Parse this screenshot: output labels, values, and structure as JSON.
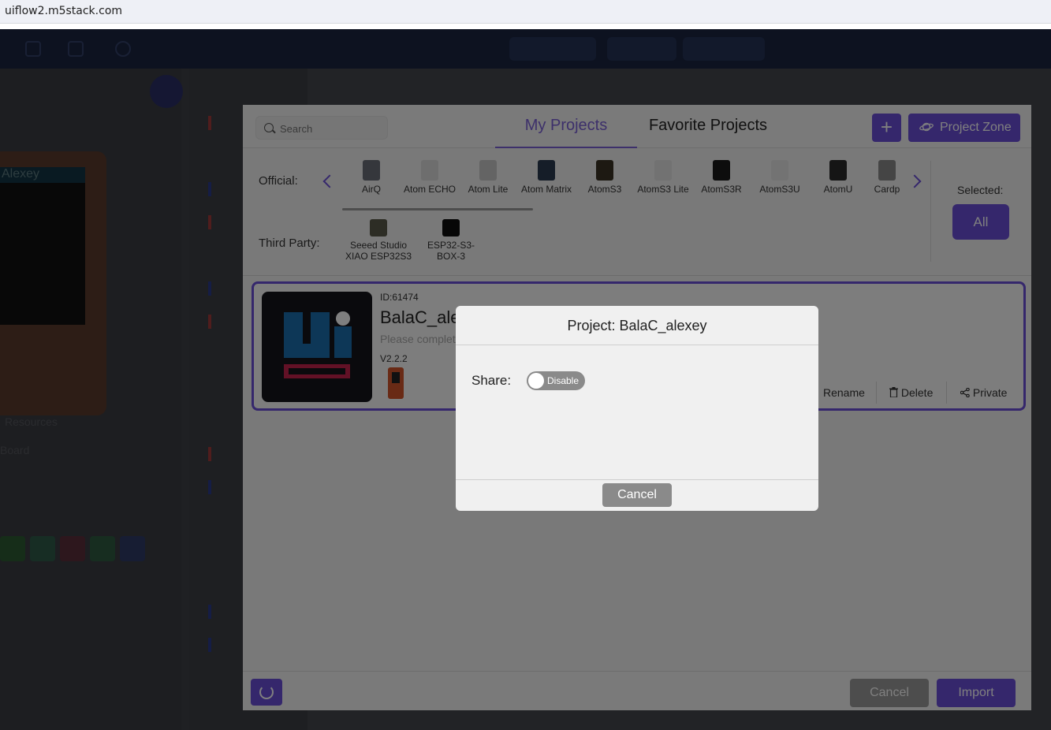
{
  "browser": {
    "url": "uiflow2.m5stack.com"
  },
  "background": {
    "device_screen_title": "Alexey",
    "sidebar_texts": [
      "Resources",
      "Board"
    ]
  },
  "project_manager": {
    "search": {
      "placeholder": "Search"
    },
    "tabs": [
      {
        "label": "My Projects",
        "active": true
      },
      {
        "label": "Favorite Projects",
        "active": false
      }
    ],
    "add_button": "+",
    "project_zone_button": "Project Zone",
    "official_label": "Official:",
    "official_devices": [
      {
        "name": "AirQ",
        "icon": "airq-device-icon",
        "color": "#6a6f78"
      },
      {
        "name": "Atom ECHO",
        "icon": "atom-echo-device-icon",
        "color": "#dcdcdc"
      },
      {
        "name": "Atom Lite",
        "icon": "atom-lite-device-icon",
        "color": "#c8c8c8"
      },
      {
        "name": "Atom Matrix",
        "icon": "atom-matrix-device-icon",
        "color": "#2a3a50"
      },
      {
        "name": "AtomS3",
        "icon": "atoms3-device-icon",
        "color": "#3a3324"
      },
      {
        "name": "AtomS3 Lite",
        "icon": "atoms3-lite-device-icon",
        "color": "#e4e4e4"
      },
      {
        "name": "AtomS3R",
        "icon": "atoms3r-device-icon",
        "color": "#1a1a1a"
      },
      {
        "name": "AtomS3U",
        "icon": "atoms3u-device-icon",
        "color": "#e6e6e6"
      },
      {
        "name": "AtomU",
        "icon": "atomu-device-icon",
        "color": "#2a2a2a"
      },
      {
        "name": "Cardp",
        "icon": "cardputer-device-icon",
        "color": "#8a8a8a"
      }
    ],
    "third_party_label": "Third Party:",
    "third_party_devices": [
      {
        "name_line1": "Seeed Studio",
        "name_line2": "XIAO ESP32S3",
        "icon": "xiao-esp32s3-device-icon",
        "color": "#5a5a4a"
      },
      {
        "name_line1": "ESP32-S3-",
        "name_line2": "BOX-3",
        "icon": "esp32-s3-box-device-icon",
        "color": "#0e0e0e"
      }
    ],
    "selected_label": "Selected:",
    "selected_value": "All",
    "project": {
      "id": "ID:61474",
      "name": "BalaC_ale",
      "description": "Please complet",
      "version": "V2.2.2",
      "actions": {
        "rename": "Rename",
        "delete": "Delete",
        "private": "Private"
      }
    },
    "footer": {
      "cancel": "Cancel",
      "import": "Import"
    }
  },
  "modal": {
    "title": "Project: BalaC_alexey",
    "share_label": "Share:",
    "share_toggle": {
      "state": "Disable",
      "enabled": false
    },
    "cancel": "Cancel"
  },
  "colors": {
    "accent": "#6b4fd8",
    "modal_bg": "#f0f0f0",
    "toggle_off": "#8a8a8a"
  }
}
